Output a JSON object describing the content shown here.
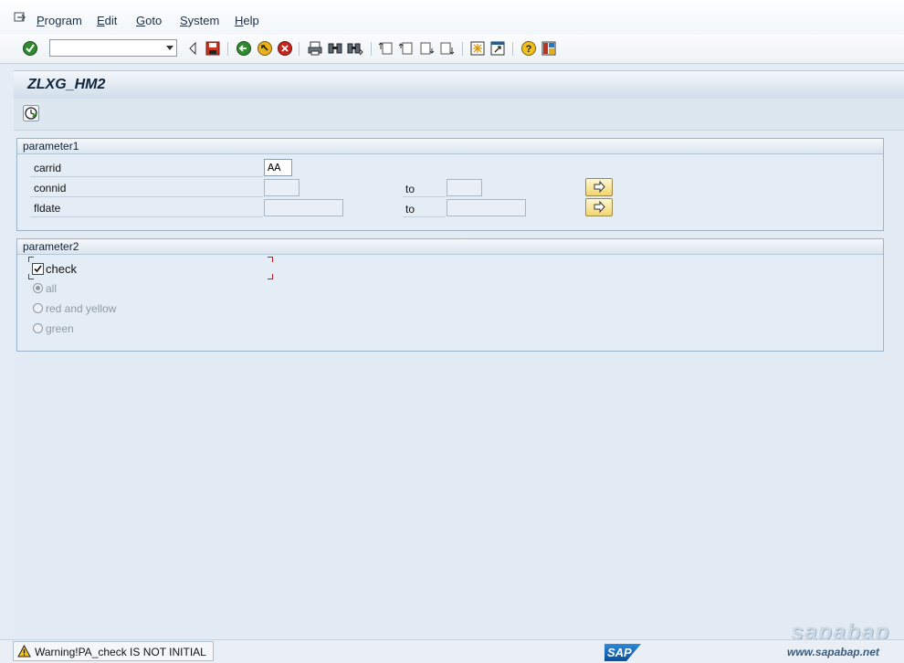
{
  "menu": {
    "items": [
      {
        "label": "Program",
        "accel": "P"
      },
      {
        "label": "Edit",
        "accel": "E"
      },
      {
        "label": "Goto",
        "accel": "G"
      },
      {
        "label": "System",
        "accel": "S"
      },
      {
        "label": "Help",
        "accel": "H"
      }
    ]
  },
  "toolbar": {
    "command_value": "",
    "icons": [
      "enter-icon",
      "back-arrow-icon",
      "save-icon",
      "back-icon",
      "exit-icon",
      "cancel-icon",
      "print-icon",
      "find-icon",
      "find-next-icon",
      "first-page-icon",
      "previous-page-icon",
      "next-page-icon",
      "last-page-icon",
      "create-session-icon",
      "shortcut-icon",
      "help-icon",
      "layout-menu-icon"
    ]
  },
  "screen": {
    "title": "ZLXG_HM2",
    "app_toolbar_icon": "execute-icon"
  },
  "parameter1": {
    "title": "parameter1",
    "rows": [
      {
        "label": "carrid",
        "value": ""
      },
      {
        "label": "connid",
        "to": "to"
      },
      {
        "label": "fldate",
        "to": "to"
      }
    ],
    "carrid_value": "AA"
  },
  "parameter2": {
    "title": "parameter2",
    "check_label": "check",
    "check_checked": true,
    "radios": [
      {
        "label": "all",
        "selected": true
      },
      {
        "label": "red and yellow",
        "selected": false
      },
      {
        "label": "green",
        "selected": false
      }
    ]
  },
  "status": {
    "type": "warning",
    "message": "Warning!PA_check IS NOT INITIAL"
  },
  "branding": {
    "sap_logo": "SAP",
    "watermark": "sapabap",
    "watermark_url": "www.sapabap.net"
  },
  "colors": {
    "accent": "#0b4f9c",
    "warning": "#f2c21b",
    "required_marker": "#c8191e"
  }
}
